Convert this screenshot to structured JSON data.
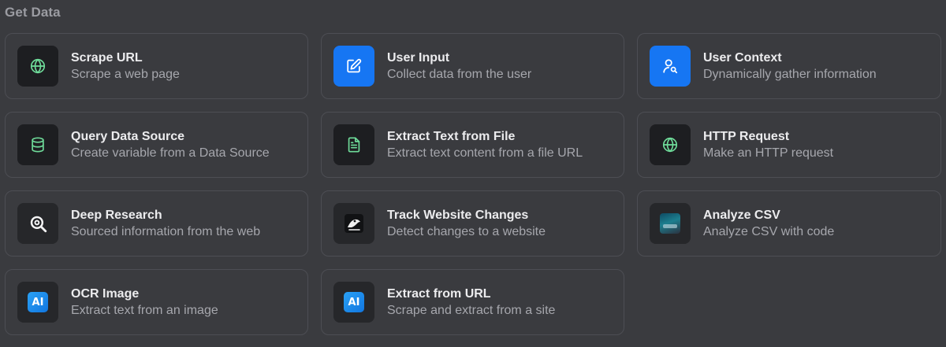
{
  "section": {
    "title": "Get Data"
  },
  "colors": {
    "accent_blue": "#1676f3",
    "icon_green": "#6fdc9a",
    "background": "#3a3b3f"
  },
  "cards": [
    {
      "title": "Scrape URL",
      "description": "Scrape a web page",
      "icon": "globe-icon"
    },
    {
      "title": "User Input",
      "description": "Collect data from the user",
      "icon": "edit-icon"
    },
    {
      "title": "User Context",
      "description": "Dynamically gather information",
      "icon": "user-search-icon"
    },
    {
      "title": "Query Data Source",
      "description": "Create variable from a Data Source",
      "icon": "database-icon"
    },
    {
      "title": "Extract Text from File",
      "description": "Extract text content from a file URL",
      "icon": "file-text-icon"
    },
    {
      "title": "HTTP Request",
      "description": "Make an HTTP request",
      "icon": "globe-icon"
    },
    {
      "title": "Deep Research",
      "description": "Sourced information from the web",
      "icon": "research-icon"
    },
    {
      "title": "Track Website Changes",
      "description": "Detect changes to a website",
      "icon": "track-changes-icon"
    },
    {
      "title": "Analyze CSV",
      "description": "Analyze CSV with code",
      "icon": "csv-image-icon"
    },
    {
      "title": "OCR Image",
      "description": "Extract text from an image",
      "icon": "ai-badge-icon",
      "badge": "AI"
    },
    {
      "title": "Extract from URL",
      "description": "Scrape and extract from a site",
      "icon": "ai-badge-icon",
      "badge": "AI"
    }
  ]
}
